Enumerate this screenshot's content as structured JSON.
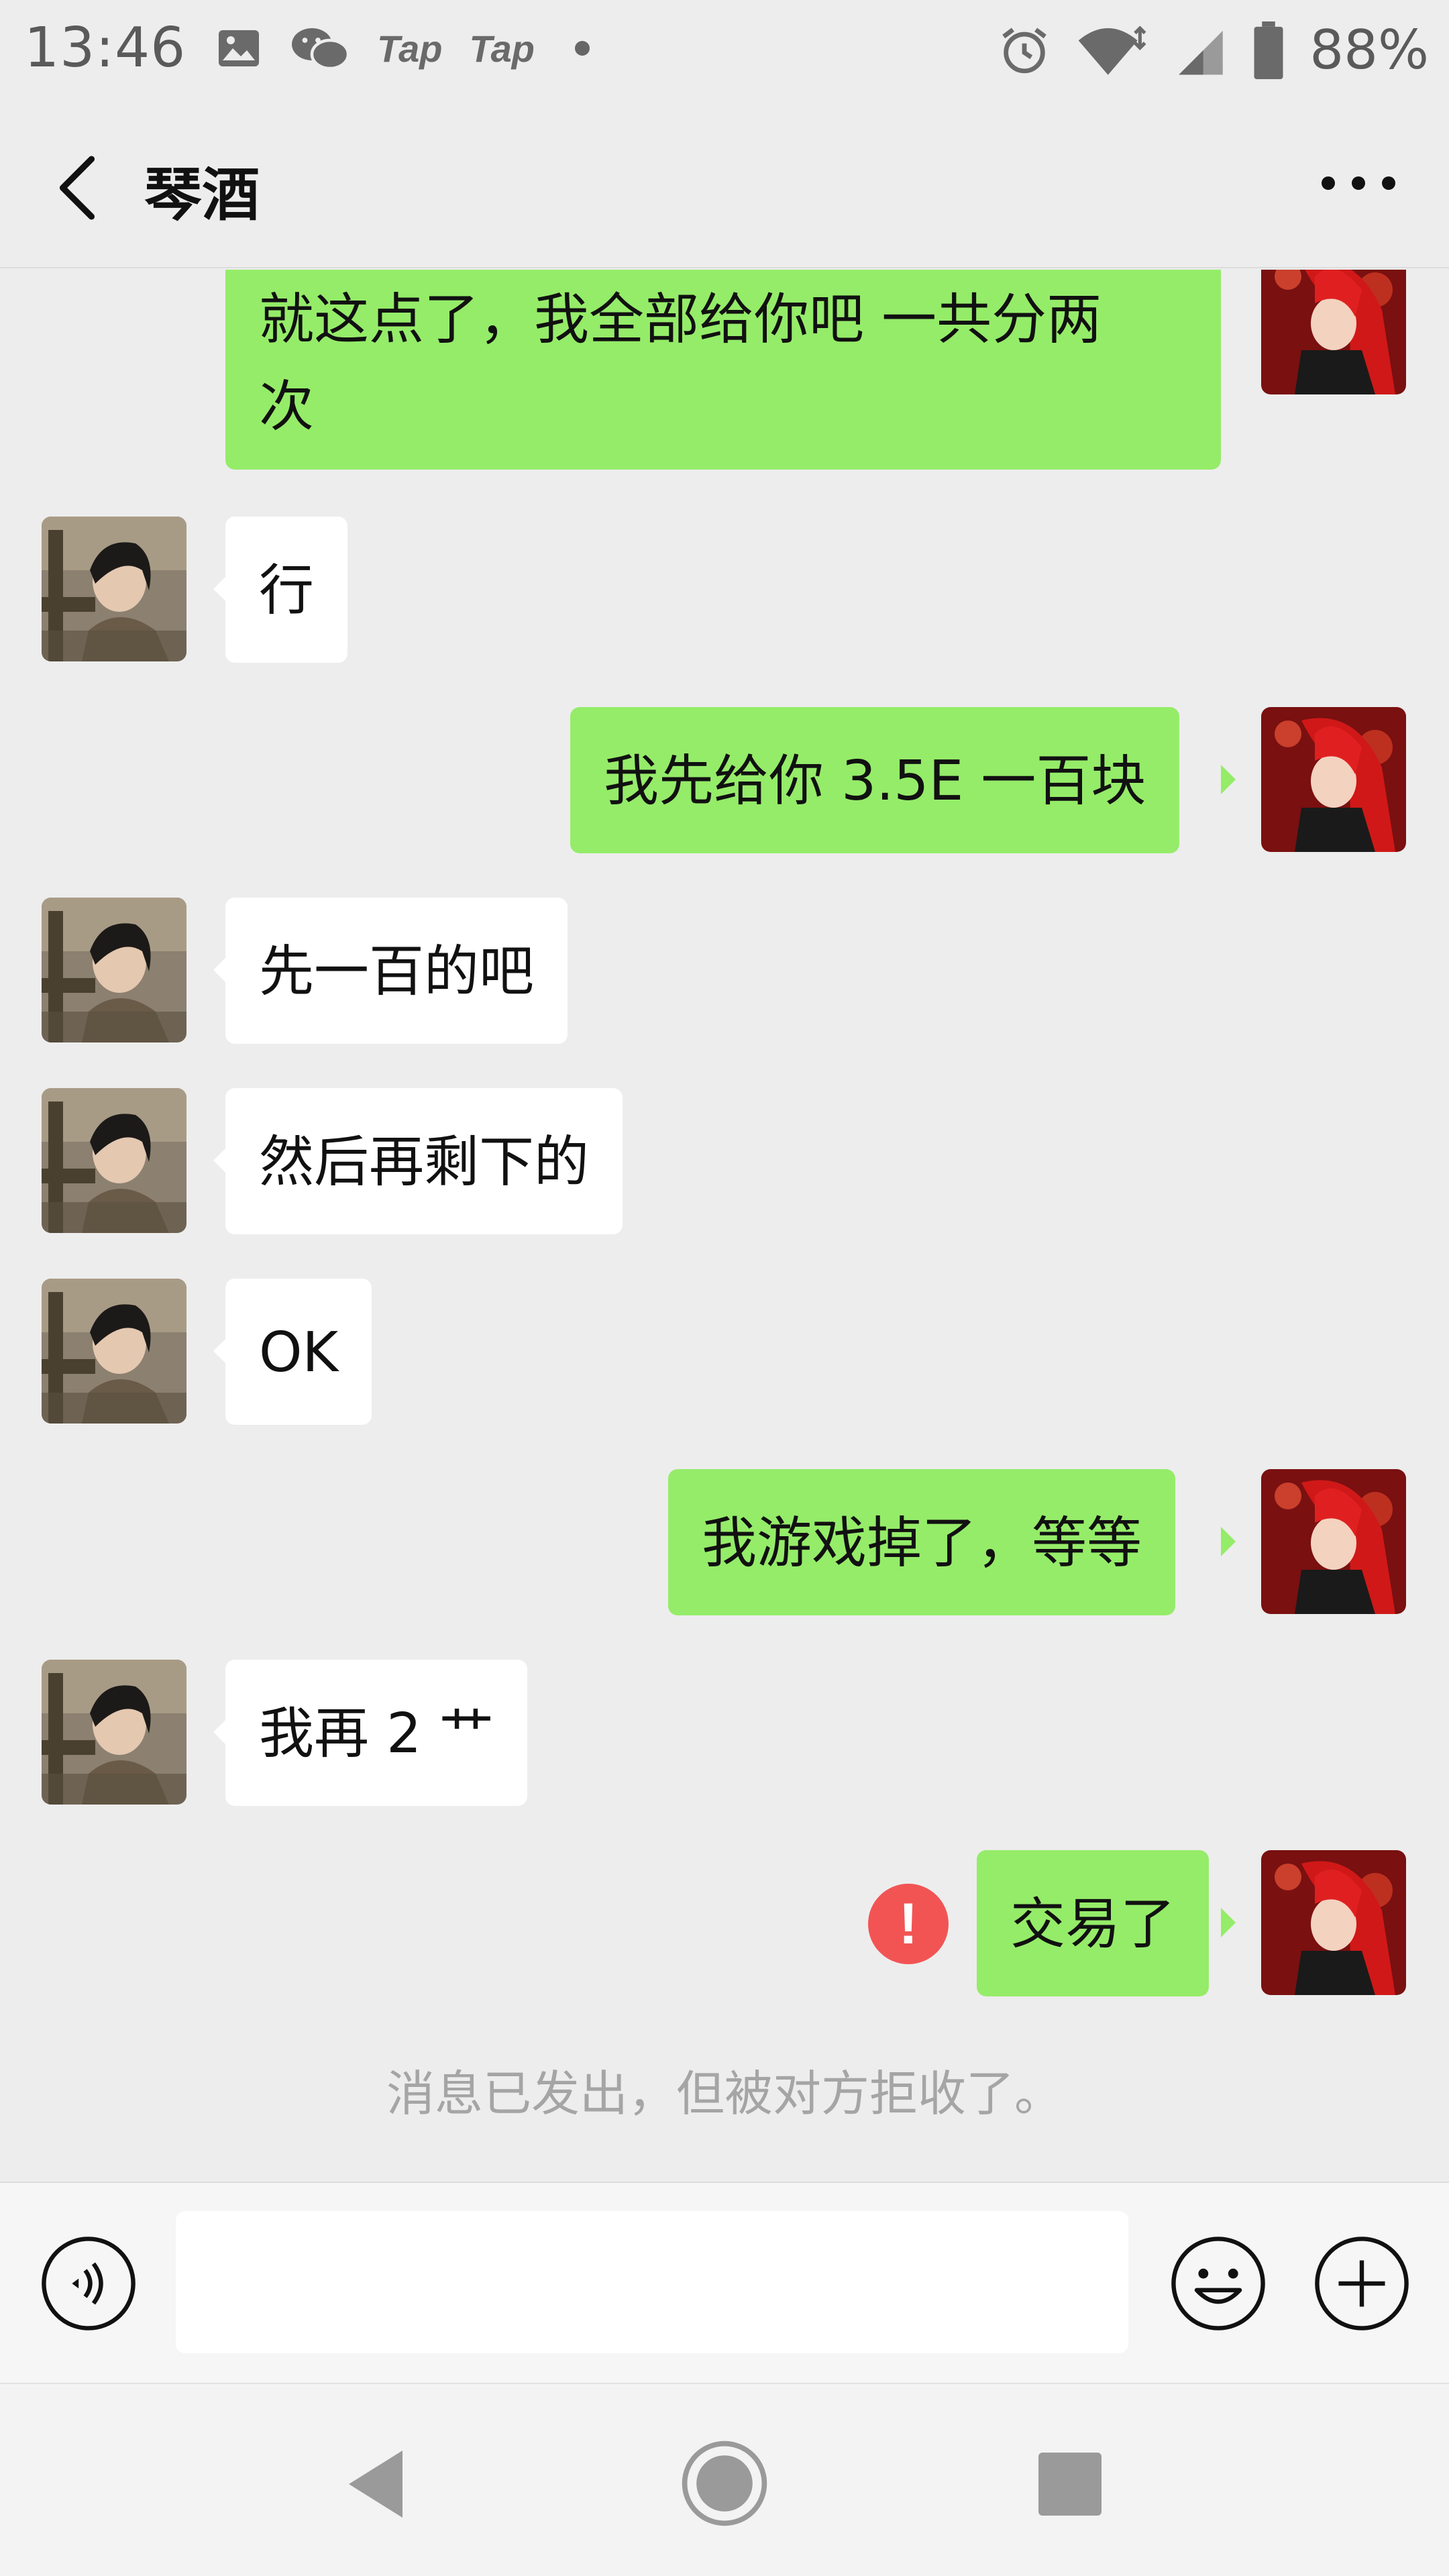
{
  "status_bar": {
    "time": "13:46",
    "left_icons": [
      "image-icon",
      "wechat-icon",
      "taptap-icon",
      "taptap-icon",
      "dot-icon"
    ],
    "tap1": "Tap",
    "tap2": "Tap",
    "battery": "88%"
  },
  "header": {
    "title": "琴酒",
    "back_icon": "chevron-left-icon",
    "more_icon": "more-icon"
  },
  "messages": [
    {
      "from": "me",
      "text_line1": "就这点了，我全部给你吧  一共分两",
      "text_line2": "次"
    },
    {
      "from": "peer",
      "text": "行"
    },
    {
      "from": "me",
      "text": "我先给你 3.5E  一百块"
    },
    {
      "from": "peer",
      "text": "先一百的吧"
    },
    {
      "from": "peer",
      "text": "然后再剩下的"
    },
    {
      "from": "peer",
      "text": "OK"
    },
    {
      "from": "me",
      "text": "我游戏掉了，等等"
    },
    {
      "from": "peer",
      "text": "我再 2 艹"
    },
    {
      "from": "me",
      "text": "交易了",
      "status": "rejected"
    }
  ],
  "error_mark": "!",
  "system_note": "消息已发出，但被对方拒收了。",
  "input_bar": {
    "value": "",
    "voice_icon": "voice-icon",
    "emoji_icon": "emoji-icon",
    "plus_icon": "plus-icon"
  },
  "colors": {
    "background": "#ededed",
    "my_bubble": "#95ec69",
    "peer_bubble": "#ffffff",
    "error": "#f25454",
    "note_text": "#a5a5a5"
  }
}
